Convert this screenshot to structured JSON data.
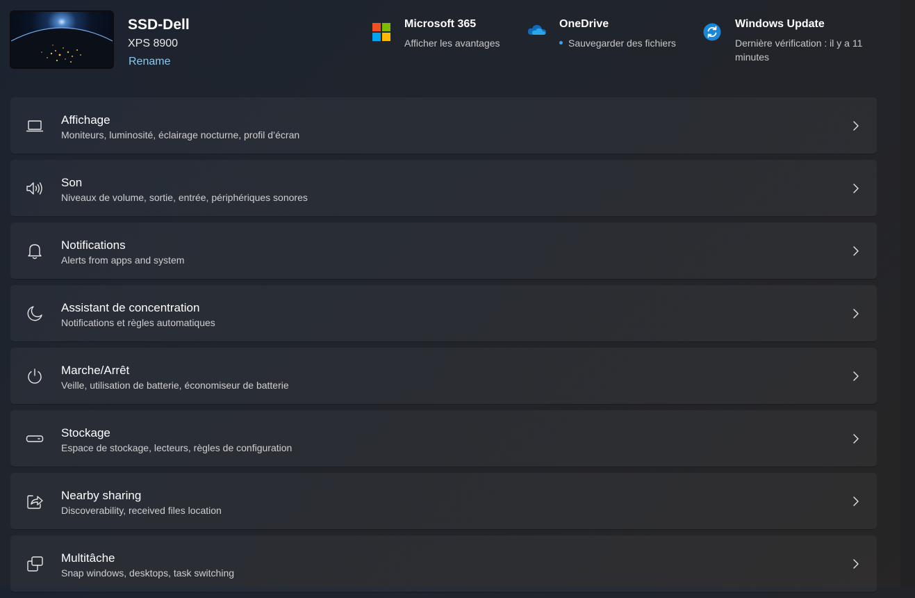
{
  "device": {
    "name": "SSD-Dell",
    "model": "XPS 8900",
    "rename_label": "Rename"
  },
  "quick_links": [
    {
      "title": "Microsoft 365",
      "subtitle": "Afficher les avantages",
      "icon": "microsoft-logo-icon"
    },
    {
      "title": "OneDrive",
      "subtitle": "Sauvegarder des fichiers",
      "icon": "cloud-icon"
    },
    {
      "title": "Windows Update",
      "subtitle": "Dernière vérification : il y a 11 minutes",
      "icon": "sync-icon"
    }
  ],
  "settings": [
    {
      "title": "Affichage",
      "description": "Moniteurs, luminosité, éclairage nocturne, profil d’écran",
      "icon": "laptop-icon"
    },
    {
      "title": "Son",
      "description": "Niveaux de volume, sortie, entrée, périphériques sonores",
      "icon": "speaker-icon"
    },
    {
      "title": "Notifications",
      "description": "Alerts from apps and system",
      "icon": "bell-icon"
    },
    {
      "title": "Assistant de concentration",
      "description": "Notifications et règles automatiques",
      "icon": "moon-icon"
    },
    {
      "title": "Marche/Arrêt",
      "description": "Veille, utilisation de batterie, économiseur de batterie",
      "icon": "power-icon"
    },
    {
      "title": "Stockage",
      "description": "Espace de stockage, lecteurs, règles de configuration",
      "icon": "storage-drive-icon"
    },
    {
      "title": "Nearby sharing",
      "description": "Discoverability, received files location",
      "icon": "share-icon"
    },
    {
      "title": "Multitâche",
      "description": "Snap windows, desktops, task switching",
      "icon": "multitask-windows-icon"
    }
  ],
  "colors": {
    "accent_link": "#8cc8f0",
    "onedrive_blue": "#0f6cbd",
    "update_blue": "#1a86d8"
  }
}
